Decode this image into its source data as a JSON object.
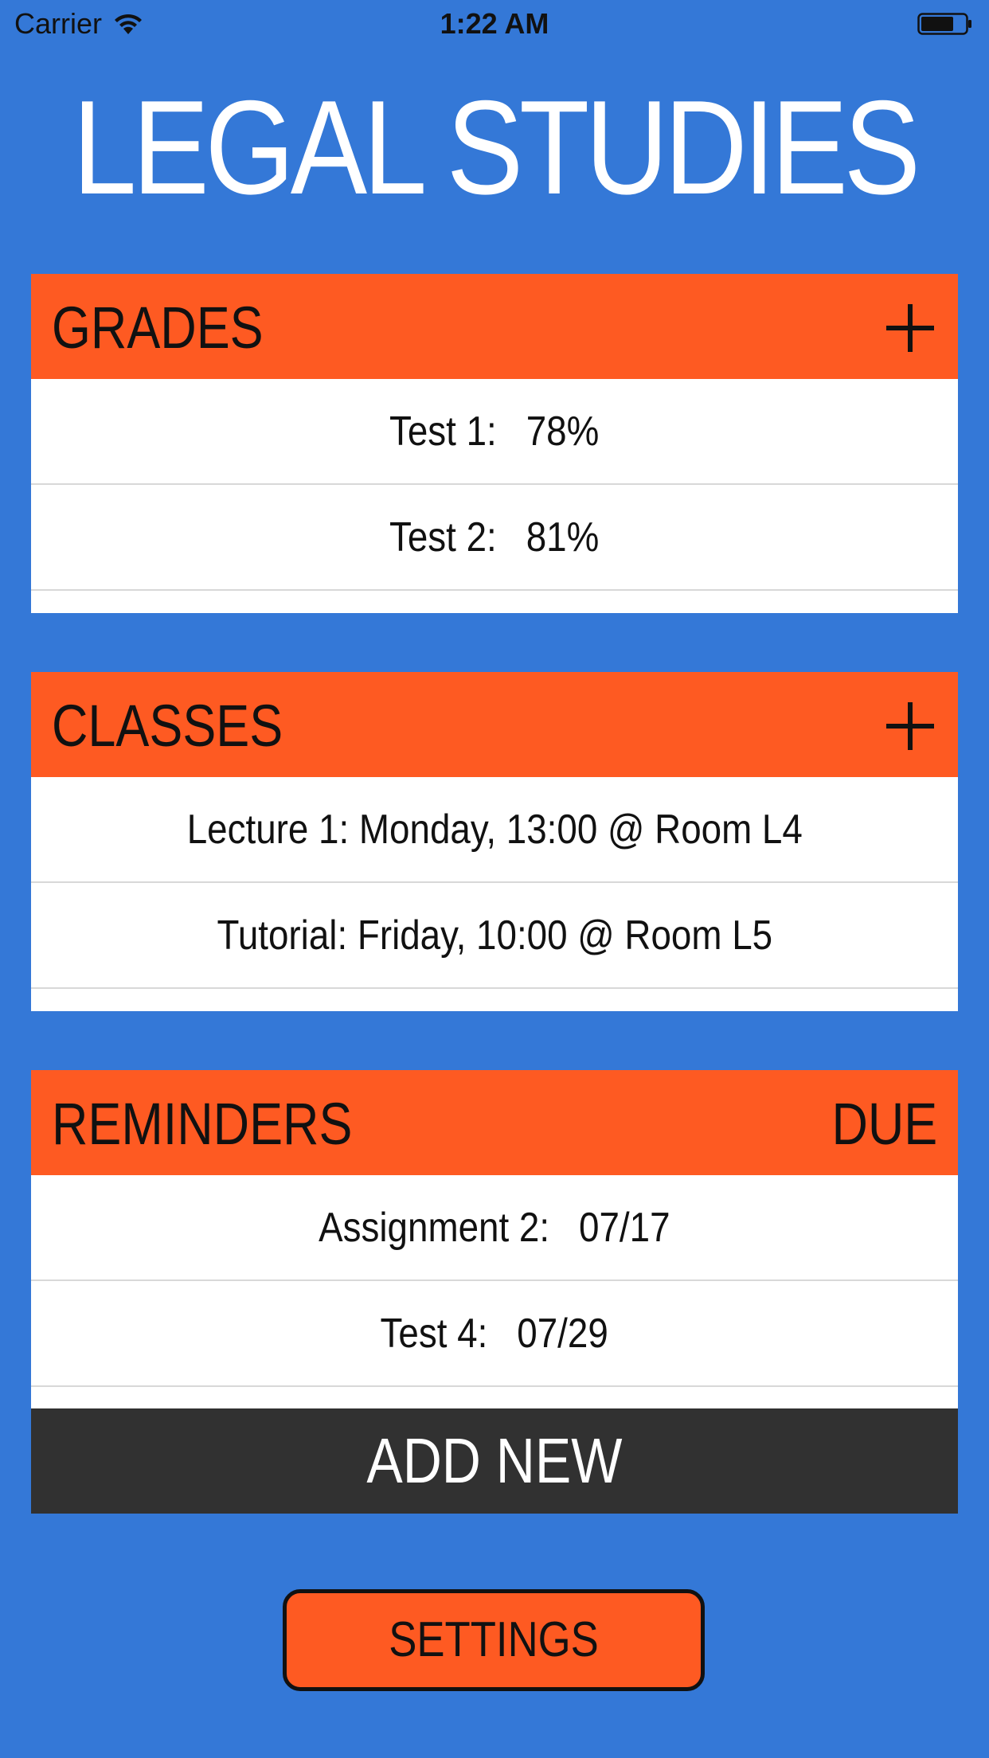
{
  "status_bar": {
    "carrier": "Carrier",
    "time": "1:22 AM"
  },
  "app": {
    "title": "LEGAL STUDIES"
  },
  "grades": {
    "title": "GRADES",
    "action_icon": "plus-icon",
    "rows": [
      {
        "label": "Test 1:",
        "value": "78%"
      },
      {
        "label": "Test 2:",
        "value": "81%"
      }
    ]
  },
  "classes": {
    "title": "CLASSES",
    "action_icon": "plus-icon",
    "rows": [
      {
        "text": "Lecture 1: Monday, 13:00 @ Room L4"
      },
      {
        "text": "Tutorial: Friday, 10:00 @ Room L5"
      }
    ]
  },
  "reminders": {
    "title": "REMINDERS",
    "action_label": "DUE",
    "rows": [
      {
        "label": "Assignment 2:",
        "value": "07/17"
      },
      {
        "label": "Test 4:",
        "value": "07/29"
      }
    ]
  },
  "buttons": {
    "add_new": "ADD NEW",
    "settings": "SETTINGS"
  },
  "colors": {
    "background": "#3478d7",
    "header": "#fe5a22",
    "dark_button": "#313131"
  }
}
